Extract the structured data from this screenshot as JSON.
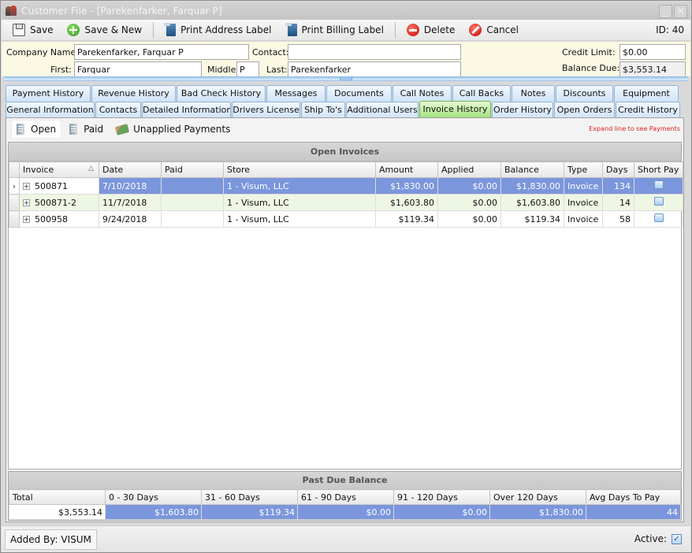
{
  "window": {
    "title": "Customer File - [Parekenfarker, Farquar P]",
    "minimize": "_",
    "close": "✕"
  },
  "toolbar": {
    "save": "Save",
    "save_new": "Save & New",
    "print_address": "Print Address Label",
    "print_billing": "Print Billing Label",
    "delete": "Delete",
    "cancel": "Cancel",
    "id": "ID: 40"
  },
  "form": {
    "company_label": "Company Name:",
    "company_value": "Parekenfarker, Farquar P",
    "contact_label": "Contact:",
    "contact_value": "",
    "first_label": "First:",
    "first_value": "Farquar",
    "middle_label": "Middle:",
    "middle_value": "P",
    "last_label": "Last:",
    "last_value": "Parekenfarker",
    "credit_limit_label": "Credit Limit:",
    "credit_limit_value": "$0.00",
    "balance_due_label": "Balance Due:",
    "balance_due_value": "$3,553.14"
  },
  "tabs": {
    "row1": [
      "Payment History",
      "Revenue History",
      "Bad Check History",
      "Messages",
      "Documents",
      "Call Notes",
      "Call Backs",
      "Notes",
      "Discounts",
      "Equipment"
    ],
    "row2": [
      "General Information",
      "Contacts",
      "Detailed Information",
      "Drivers License",
      "Ship To's",
      "Additional Users",
      "Invoice History",
      "Order History",
      "Open Orders",
      "Credit History"
    ],
    "active": "Invoice History"
  },
  "subtoolbar": {
    "open": "Open",
    "paid": "Paid",
    "unapplied": "Unapplied Payments",
    "hint": "Expand line to see Payments"
  },
  "open_invoices": {
    "title": "Open Invoices",
    "columns": [
      "Invoice",
      "Date",
      "Paid",
      "Store",
      "Amount",
      "Applied",
      "Balance",
      "Type",
      "Days",
      "Short Pay"
    ],
    "sort_icon": "△",
    "rows": [
      {
        "invoice": "500871",
        "date": "7/10/2018",
        "paid": "",
        "store": "1 - Visum, LLC",
        "amount": "$1,830.00",
        "applied": "$0.00",
        "balance": "$1,830.00",
        "type": "Invoice",
        "days": "134",
        "short_pay": false
      },
      {
        "invoice": "500871-2",
        "date": "11/7/2018",
        "paid": "",
        "store": "1 - Visum, LLC",
        "amount": "$1,603.80",
        "applied": "$0.00",
        "balance": "$1,603.80",
        "type": "Invoice",
        "days": "14",
        "short_pay": false
      },
      {
        "invoice": "500958",
        "date": "9/24/2018",
        "paid": "",
        "store": "1 - Visum, LLC",
        "amount": "$119.34",
        "applied": "$0.00",
        "balance": "$119.34",
        "type": "Invoice",
        "days": "58",
        "short_pay": false
      }
    ],
    "selected_row": 0
  },
  "past_due": {
    "title": "Past Due Balance",
    "columns": [
      "Total",
      "0 - 30 Days",
      "31 - 60 Days",
      "61 - 90 Days",
      "91 - 120 Days",
      "Over 120 Days",
      "Avg Days To Pay"
    ],
    "values": [
      "$3,553.14",
      "$1,603.80",
      "$119.34",
      "$0.00",
      "$0.00",
      "$1,830.00",
      "44"
    ]
  },
  "footer": {
    "added_by": "Added By: VISUM",
    "active_label": "Active:",
    "active_checked": true
  }
}
